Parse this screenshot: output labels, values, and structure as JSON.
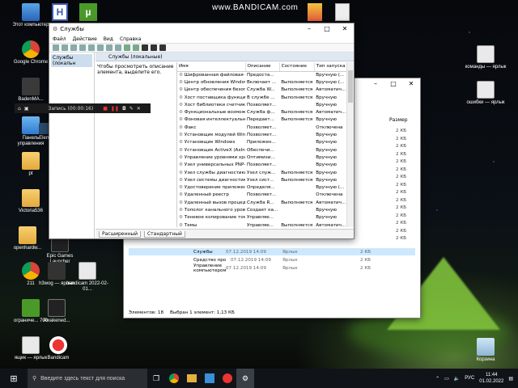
{
  "watermark": "www.BANDICAM.com",
  "desktop_icons": [
    {
      "label": "Этот компьютер"
    },
    {
      "label": "Google Chrome"
    },
    {
      "label": "BadenMA..."
    },
    {
      "label": "Панель управления"
    },
    {
      "label": "Elem"
    },
    {
      "label": "pt"
    },
    {
      "label": "Victoria536"
    },
    {
      "label": "openhardw..."
    },
    {
      "label": "Epic Games Launcher"
    },
    {
      "label": "211"
    },
    {
      "label": "h3wog — ярлык"
    },
    {
      "label": "bandicam 2022-02-01..."
    },
    {
      "label": "ограниче... 700"
    },
    {
      "label": "Awakened..."
    },
    {
      "label": "ящик — ярлык"
    },
    {
      "label": "Bandicam"
    },
    {
      "label": "команды — ярлык"
    },
    {
      "label": "ошибки — ярлык"
    },
    {
      "label": "Корзина"
    }
  ],
  "services_window": {
    "title": "Службы",
    "menu": [
      "Файл",
      "Действие",
      "Вид",
      "Справка"
    ],
    "tree_item": "Службы (локальн",
    "pane_header": "Службы (локальные)",
    "description": "Чтобы просмотреть описание элемента, выделите его.",
    "columns": [
      "Имя",
      "Описание",
      "Состояние",
      "Тип запуска"
    ],
    "rows": [
      [
        "Шифрованная файловая с...",
        "Предоста...",
        "",
        "Вручную (..."
      ],
      [
        "Центр обновления Windows",
        "Включает ...",
        "Выполняется",
        "Вручную (..."
      ],
      [
        "Центр обеспечения безоп...",
        "Служба W...",
        "Выполняется",
        "Автоматич..."
      ],
      [
        "Хост поставщика функции...",
        "В службе ...",
        "Выполняется",
        "Вручную"
      ],
      [
        "Хост библиотеки счетчика...",
        "Позволяет...",
        "",
        "Вручную"
      ],
      [
        "Функциональные возмож...",
        "Служба ф...",
        "Выполняется",
        "Автоматич..."
      ],
      [
        "Фоновая интеллектуальна...",
        "Передает...",
        "Выполняется",
        "Вручную"
      ],
      [
        "Факс",
        "Позволяет...",
        "",
        "Отключена"
      ],
      [
        "Установщик модулей Win...",
        "Позволяет...",
        "",
        "Вручную"
      ],
      [
        "Установщик Windows",
        "Приложен...",
        "",
        "Вручную"
      ],
      [
        "Установщик ActiveX (AxIns...",
        "Обеспечи...",
        "",
        "Вручную"
      ],
      [
        "Управление уровнями хра...",
        "Оптимизи...",
        "",
        "Вручную"
      ],
      [
        "Узел универсальных PNP-...",
        "Позволяет...",
        "",
        "Вручную"
      ],
      [
        "Узел службы диагностики",
        "Узел служ...",
        "Выполняется",
        "Вручную"
      ],
      [
        "Узел системы диагностики",
        "Узел сист...",
        "Выполняется",
        "Вручную"
      ],
      [
        "Удостоверение приложения",
        "Определя...",
        "",
        "Вручную (..."
      ],
      [
        "Удаленный реестр",
        "Позволяет...",
        "",
        "Отключена"
      ],
      [
        "Удаленный вызов процеду...",
        "Служба R...",
        "Выполняется",
        "Автоматич..."
      ],
      [
        "Тополог канального уровня",
        "Создает ка...",
        "",
        "Вручную"
      ],
      [
        "Теневое копирование тома",
        "Управляе...",
        "",
        "Вручную"
      ],
      [
        "Темы",
        "Управляе...",
        "Выполняется",
        "Автоматич..."
      ]
    ],
    "tabs": [
      "Расширенный",
      "Стандартный"
    ]
  },
  "explorer_window": {
    "size_header": "Размер",
    "sizes": [
      "2 КБ",
      "2 КБ",
      "2 КБ",
      "2 КБ",
      "2 КБ",
      "2 КБ",
      "2 КБ",
      "2 КБ",
      "2 КБ",
      "2 КБ",
      "2 КБ",
      "2 КБ",
      "2 КБ",
      "2 КБ",
      "2 КБ"
    ],
    "files": [
      {
        "name": "Службы",
        "date": "07.12.2019 14:09",
        "type": "Ярлык",
        "size": "2 КБ"
      },
      {
        "name": "Средство проверки памяти Windows",
        "date": "07.12.2019 14:09",
        "type": "Ярлык",
        "size": "2 КБ"
      },
      {
        "name": "Управление компьютером",
        "date": "07.12.2019 14:09",
        "type": "Ярлык",
        "size": "2 КБ"
      }
    ],
    "status_items": "Элементов: 18",
    "status_selected": "Выбран 1 элемент: 1,13 КБ"
  },
  "recorder": {
    "label": "Запись (00:00:16)"
  },
  "taskbar": {
    "search_placeholder": "Введите здесь текст для поиска",
    "lang": "РУС",
    "time": "11:44",
    "date": "01.02.2022"
  }
}
